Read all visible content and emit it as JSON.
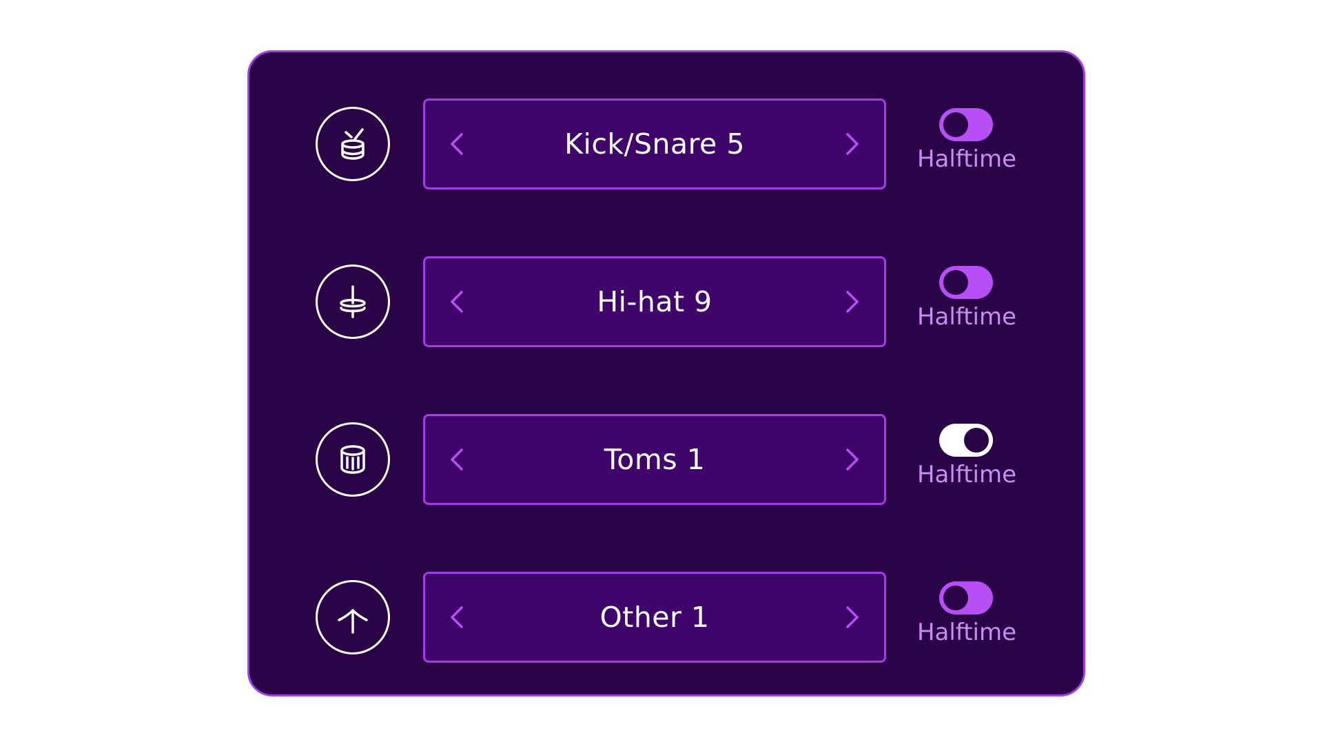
{
  "colors": {
    "panel_background": "#2b0448",
    "panel_border": "#a23de8",
    "selector_background": "#40056b",
    "accent": "#b84ef5",
    "toggle_label": "#c98cf2",
    "icon": "#ffffff"
  },
  "rows": [
    {
      "icon": "snare-drum-icon",
      "preset": "Kick/Snare 5",
      "toggle_label": "Halftime",
      "toggle_on": false
    },
    {
      "icon": "hi-hat-icon",
      "preset": "Hi-hat 9",
      "toggle_label": "Halftime",
      "toggle_on": false
    },
    {
      "icon": "tom-drum-icon",
      "preset": "Toms 1",
      "toggle_label": "Halftime",
      "toggle_on": true
    },
    {
      "icon": "cymbal-icon",
      "preset": "Other 1",
      "toggle_label": "Halftime",
      "toggle_on": false
    }
  ]
}
